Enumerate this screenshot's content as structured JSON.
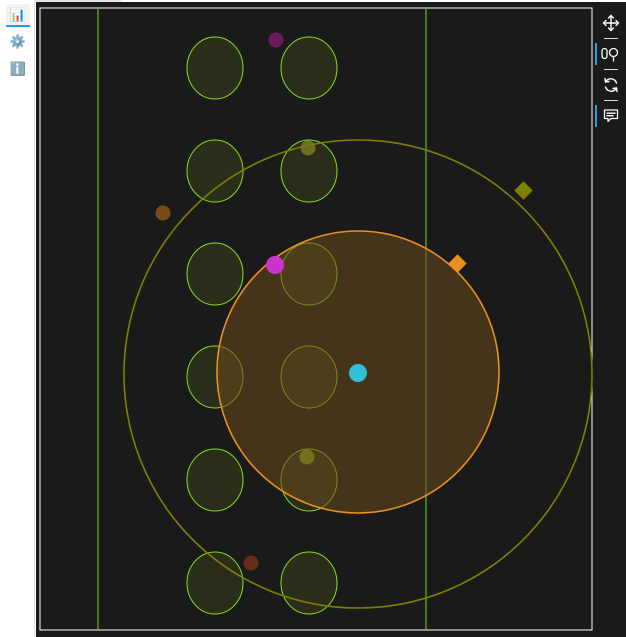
{
  "sidebar": {
    "items": [
      {
        "name": "chart-icon",
        "glyph": "📊"
      },
      {
        "name": "gear-icon",
        "glyph": "⚙️"
      },
      {
        "name": "info-icon",
        "glyph": "ℹ️"
      }
    ]
  },
  "toolbar": {
    "tools": [
      {
        "name": "pan-tool",
        "icon": "move-arrows-icon"
      },
      {
        "name": "wheel-zoom-tool",
        "icon": "magnifier-zoom-icon"
      },
      {
        "name": "reset-tool",
        "icon": "reset-arrows-icon"
      },
      {
        "name": "hover-tool",
        "icon": "speech-bubble-icon"
      }
    ]
  },
  "plot": {
    "background": "#1a1a1a",
    "frame_color": "#ffffff",
    "line_color": "#66bb22",
    "ellipse_stroke": "#88dd22",
    "large_circle_color": "#808000",
    "orange_circle_color": "#e89020",
    "orange_fill": "#5a3d18",
    "center_marker_color": "#30c0d8",
    "magenta_marker_color": "#cc33cc",
    "olive_diamond_color": "#808000",
    "orange_diamond_color": "#e89020",
    "dark_magenta_dot_color": "#6b1a5a",
    "brown_dot_color": "#7a4a1a",
    "olive_dot_color": "#7a7a20",
    "dark_red_dot_color": "#6a2a1a"
  }
}
